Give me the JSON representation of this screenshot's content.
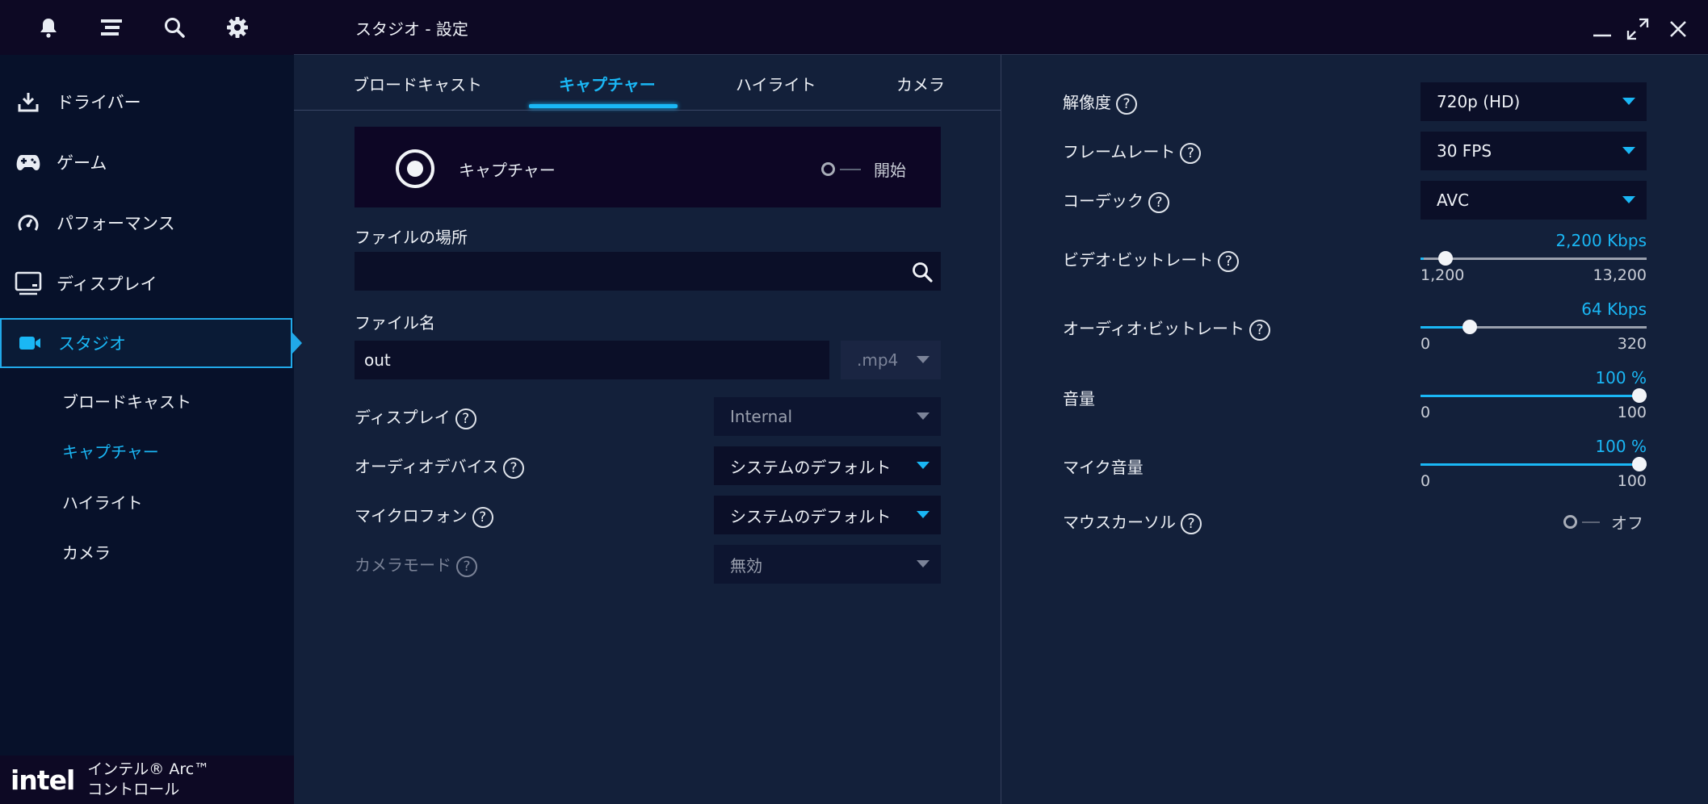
{
  "app": {
    "title": "スタジオ - 設定",
    "brand_logo": "intel",
    "brand_line1": "インテル® Arc™",
    "brand_line2": "コントロール",
    "accent_color": "#1ab7f5"
  },
  "topbar_icons": [
    "bell-icon",
    "menu-icon",
    "search-icon",
    "gear-icon"
  ],
  "sidebar": {
    "items": [
      {
        "label": "ドライバー",
        "icon": "download-icon"
      },
      {
        "label": "ゲーム",
        "icon": "gamepad-icon"
      },
      {
        "label": "パフォーマンス",
        "icon": "gauge-icon"
      },
      {
        "label": "ディスプレイ",
        "icon": "monitor-icon"
      },
      {
        "label": "スタジオ",
        "icon": "camera-icon",
        "active": true
      }
    ],
    "subitems": [
      {
        "label": "ブロードキャスト"
      },
      {
        "label": "キャプチャー",
        "active": true
      },
      {
        "label": "ハイライト"
      },
      {
        "label": "カメラ"
      }
    ]
  },
  "tabs": [
    {
      "label": "ブロードキャスト"
    },
    {
      "label": "キャプチャー",
      "active": true
    },
    {
      "label": "ハイライト"
    },
    {
      "label": "カメラ"
    }
  ],
  "capture": {
    "label": "キャプチャー",
    "toggle_label": "開始",
    "toggle_on": false
  },
  "file_location": {
    "label": "ファイルの場所",
    "value": ""
  },
  "file_name": {
    "label": "ファイル名",
    "value": "out",
    "extension": ".mp4"
  },
  "left_settings": [
    {
      "label": "ディスプレイ",
      "value": "Internal",
      "state": "disabled"
    },
    {
      "label": "オーディオデバイス",
      "value": "システムのデフォルト",
      "state": "enabled"
    },
    {
      "label": "マイクロフォン",
      "value": "システムのデフォルト",
      "state": "enabled"
    },
    {
      "label": "カメラモード",
      "value": "無効",
      "state": "disabled-label"
    }
  ],
  "right_selects": [
    {
      "label": "解像度",
      "value": "720p (HD)"
    },
    {
      "label": "フレームレート",
      "value": "30 FPS"
    },
    {
      "label": "コーデック",
      "value": "AVC"
    }
  ],
  "sliders": [
    {
      "label": "ビデオ·ビットレート",
      "value_text": "2,200 Kbps",
      "min": "1,200",
      "max": "13,200",
      "fraction": 0.083,
      "help": true
    },
    {
      "label": "オーディオ·ビットレート",
      "value_text": "64 Kbps",
      "min": "0",
      "max": "320",
      "fraction": 0.2,
      "help": true
    },
    {
      "label": "音量",
      "value_text": "100 %",
      "min": "0",
      "max": "100",
      "fraction": 1.0,
      "help": false
    },
    {
      "label": "マイク音量",
      "value_text": "100 %",
      "min": "0",
      "max": "100",
      "fraction": 1.0,
      "help": false
    }
  ],
  "mouse_cursor": {
    "label": "マウスカーソル",
    "toggle_label": "オフ",
    "toggle_on": false
  },
  "help_glyph": "?"
}
